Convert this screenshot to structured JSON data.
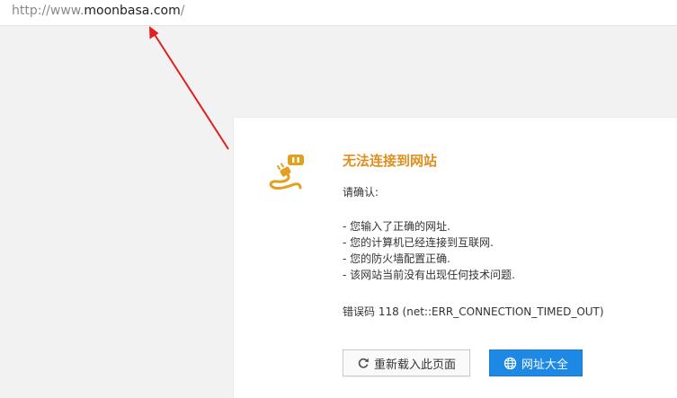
{
  "address_bar": {
    "prefix": "http://www.",
    "domain": "moonbasa.com",
    "suffix": "/"
  },
  "error": {
    "title": "无法连接到网站",
    "confirm_label": "请确认:",
    "checks": [
      "- 您输入了正确的网址.",
      "- 您的计算机已经连接到互联网.",
      "- 您的防火墙配置正确.",
      "- 该网站当前没有出现任何技术问题."
    ],
    "error_code": "错误码 118 (net::ERR_CONNECTION_TIMED_OUT)"
  },
  "buttons": {
    "reload_label": "重新载入此页面",
    "nav_label": "网址大全"
  },
  "icons": {
    "plug": "plug-disconnected-icon",
    "reload": "refresh-icon",
    "nav": "globe-icon"
  },
  "colors": {
    "title": "#e08f1e",
    "plug": "#e3a020",
    "arrow": "#e02020",
    "primary_button": "#1e88e5"
  }
}
